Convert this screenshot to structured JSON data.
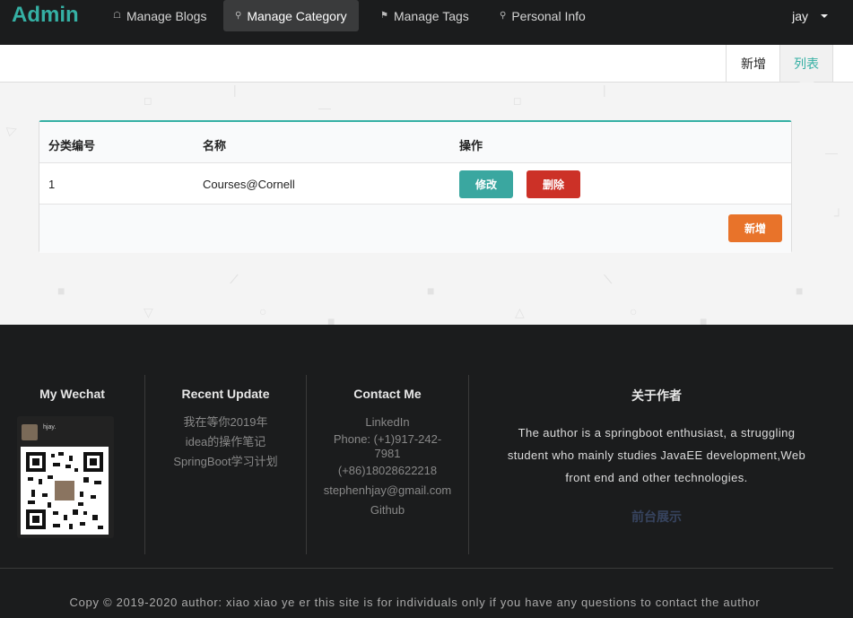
{
  "nav": {
    "brand": "Admin",
    "items": [
      {
        "label": "Manage Blogs"
      },
      {
        "label": "Manage Category"
      },
      {
        "label": "Manage Tags"
      },
      {
        "label": "Personal Info"
      }
    ],
    "user": "jay"
  },
  "submenu": {
    "new_label": "新增",
    "list_label": "列表"
  },
  "table": {
    "headers": [
      "分类编号",
      "名称",
      "操作"
    ],
    "rows": [
      {
        "id": "1",
        "name": "Courses@Cornell",
        "edit_label": "修改",
        "delete_label": "删除"
      }
    ],
    "add_label": "新增"
  },
  "footer": {
    "wechat": {
      "title": "My Wechat",
      "card_name": "hjay."
    },
    "recent": {
      "title": "Recent Update",
      "items": [
        "我在等你2019年",
        "idea的操作笔记",
        "SpringBoot学习计划"
      ]
    },
    "contact": {
      "title": "Contact Me",
      "linkedin": "LinkedIn",
      "phone1": "Phone: (+1)917-242-",
      "phone2": "7981",
      "phone3": "(+86)18028622218",
      "email": "stephenhjay@gmail.com",
      "github": "Github"
    },
    "about": {
      "title": "关于作者",
      "line1": "The author is a springboot enthusiast, a struggling",
      "line2": "student who mainly studies JavaEE development,Web",
      "line3": "front end and other technologies.",
      "link": "前台展示"
    },
    "copyright": "Copy © 2019-2020 author: xiao xiao ye er this site is for individuals only if you have any questions to contact the author"
  },
  "colors": {
    "nav_bg": "#1b1c1d",
    "brand": "#35b0a4",
    "edit_button": "#3aa7a0",
    "delete_button": "#cc3127",
    "add_button": "#e8732a"
  }
}
